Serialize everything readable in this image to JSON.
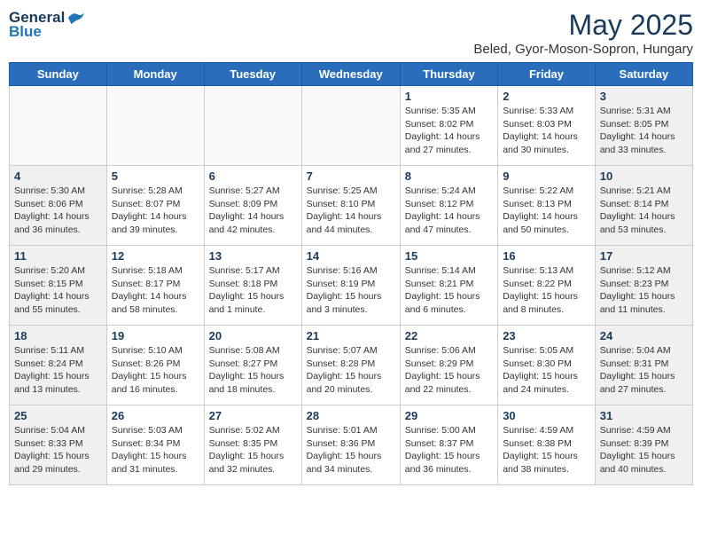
{
  "header": {
    "logo_general": "General",
    "logo_blue": "Blue",
    "month_title": "May 2025",
    "subtitle": "Beled, Gyor-Moson-Sopron, Hungary"
  },
  "days_of_week": [
    "Sunday",
    "Monday",
    "Tuesday",
    "Wednesday",
    "Thursday",
    "Friday",
    "Saturday"
  ],
  "weeks": [
    [
      {
        "day": "",
        "info": ""
      },
      {
        "day": "",
        "info": ""
      },
      {
        "day": "",
        "info": ""
      },
      {
        "day": "",
        "info": ""
      },
      {
        "day": "1",
        "info": "Sunrise: 5:35 AM\nSunset: 8:02 PM\nDaylight: 14 hours\nand 27 minutes."
      },
      {
        "day": "2",
        "info": "Sunrise: 5:33 AM\nSunset: 8:03 PM\nDaylight: 14 hours\nand 30 minutes."
      },
      {
        "day": "3",
        "info": "Sunrise: 5:31 AM\nSunset: 8:05 PM\nDaylight: 14 hours\nand 33 minutes."
      }
    ],
    [
      {
        "day": "4",
        "info": "Sunrise: 5:30 AM\nSunset: 8:06 PM\nDaylight: 14 hours\nand 36 minutes."
      },
      {
        "day": "5",
        "info": "Sunrise: 5:28 AM\nSunset: 8:07 PM\nDaylight: 14 hours\nand 39 minutes."
      },
      {
        "day": "6",
        "info": "Sunrise: 5:27 AM\nSunset: 8:09 PM\nDaylight: 14 hours\nand 42 minutes."
      },
      {
        "day": "7",
        "info": "Sunrise: 5:25 AM\nSunset: 8:10 PM\nDaylight: 14 hours\nand 44 minutes."
      },
      {
        "day": "8",
        "info": "Sunrise: 5:24 AM\nSunset: 8:12 PM\nDaylight: 14 hours\nand 47 minutes."
      },
      {
        "day": "9",
        "info": "Sunrise: 5:22 AM\nSunset: 8:13 PM\nDaylight: 14 hours\nand 50 minutes."
      },
      {
        "day": "10",
        "info": "Sunrise: 5:21 AM\nSunset: 8:14 PM\nDaylight: 14 hours\nand 53 minutes."
      }
    ],
    [
      {
        "day": "11",
        "info": "Sunrise: 5:20 AM\nSunset: 8:15 PM\nDaylight: 14 hours\nand 55 minutes."
      },
      {
        "day": "12",
        "info": "Sunrise: 5:18 AM\nSunset: 8:17 PM\nDaylight: 14 hours\nand 58 minutes."
      },
      {
        "day": "13",
        "info": "Sunrise: 5:17 AM\nSunset: 8:18 PM\nDaylight: 15 hours\nand 1 minute."
      },
      {
        "day": "14",
        "info": "Sunrise: 5:16 AM\nSunset: 8:19 PM\nDaylight: 15 hours\nand 3 minutes."
      },
      {
        "day": "15",
        "info": "Sunrise: 5:14 AM\nSunset: 8:21 PM\nDaylight: 15 hours\nand 6 minutes."
      },
      {
        "day": "16",
        "info": "Sunrise: 5:13 AM\nSunset: 8:22 PM\nDaylight: 15 hours\nand 8 minutes."
      },
      {
        "day": "17",
        "info": "Sunrise: 5:12 AM\nSunset: 8:23 PM\nDaylight: 15 hours\nand 11 minutes."
      }
    ],
    [
      {
        "day": "18",
        "info": "Sunrise: 5:11 AM\nSunset: 8:24 PM\nDaylight: 15 hours\nand 13 minutes."
      },
      {
        "day": "19",
        "info": "Sunrise: 5:10 AM\nSunset: 8:26 PM\nDaylight: 15 hours\nand 16 minutes."
      },
      {
        "day": "20",
        "info": "Sunrise: 5:08 AM\nSunset: 8:27 PM\nDaylight: 15 hours\nand 18 minutes."
      },
      {
        "day": "21",
        "info": "Sunrise: 5:07 AM\nSunset: 8:28 PM\nDaylight: 15 hours\nand 20 minutes."
      },
      {
        "day": "22",
        "info": "Sunrise: 5:06 AM\nSunset: 8:29 PM\nDaylight: 15 hours\nand 22 minutes."
      },
      {
        "day": "23",
        "info": "Sunrise: 5:05 AM\nSunset: 8:30 PM\nDaylight: 15 hours\nand 24 minutes."
      },
      {
        "day": "24",
        "info": "Sunrise: 5:04 AM\nSunset: 8:31 PM\nDaylight: 15 hours\nand 27 minutes."
      }
    ],
    [
      {
        "day": "25",
        "info": "Sunrise: 5:04 AM\nSunset: 8:33 PM\nDaylight: 15 hours\nand 29 minutes."
      },
      {
        "day": "26",
        "info": "Sunrise: 5:03 AM\nSunset: 8:34 PM\nDaylight: 15 hours\nand 31 minutes."
      },
      {
        "day": "27",
        "info": "Sunrise: 5:02 AM\nSunset: 8:35 PM\nDaylight: 15 hours\nand 32 minutes."
      },
      {
        "day": "28",
        "info": "Sunrise: 5:01 AM\nSunset: 8:36 PM\nDaylight: 15 hours\nand 34 minutes."
      },
      {
        "day": "29",
        "info": "Sunrise: 5:00 AM\nSunset: 8:37 PM\nDaylight: 15 hours\nand 36 minutes."
      },
      {
        "day": "30",
        "info": "Sunrise: 4:59 AM\nSunset: 8:38 PM\nDaylight: 15 hours\nand 38 minutes."
      },
      {
        "day": "31",
        "info": "Sunrise: 4:59 AM\nSunset: 8:39 PM\nDaylight: 15 hours\nand 40 minutes."
      }
    ]
  ]
}
